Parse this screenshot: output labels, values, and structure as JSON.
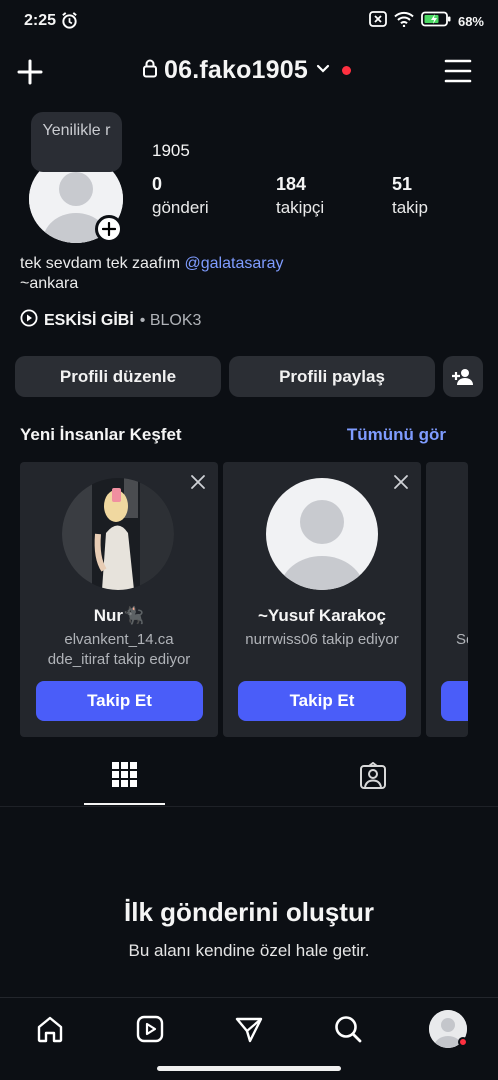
{
  "status_bar": {
    "time": "2:25",
    "battery": "68%"
  },
  "header": {
    "username": "06.fako1905"
  },
  "tooltip": {
    "text": "Yenilikle r"
  },
  "profile": {
    "name": "1905",
    "stats": [
      {
        "value": "0",
        "label": "gönderi"
      },
      {
        "value": "184",
        "label": "takipçi"
      },
      {
        "value": "51",
        "label": "takip"
      }
    ],
    "bio_line1": "tek sevdam tek zaafım ",
    "bio_mention": "@galatasaray",
    "bio_line2": "~ankara",
    "music_title": "ESKİSİ GİBİ",
    "music_artist": "• BLOK3"
  },
  "actions": {
    "edit": "Profili düzenle",
    "share": "Profili paylaş"
  },
  "discover": {
    "title": "Yeni İnsanlar Keşfet",
    "see_all": "Tümünü gör",
    "cards": [
      {
        "name": "Nur🐈‍⬛",
        "subtitle_line1": "elvankent_14.ca",
        "subtitle_line2": "dde_itiraf takip ediyor",
        "button": "Takip Et"
      },
      {
        "name": "~Yusuf Karakoç",
        "subtitle_line1": "nurrwiss06 takip ediyor",
        "subtitle_line2": "",
        "button": "Takip Et"
      },
      {
        "name": "",
        "subtitle_line1": "Se",
        "subtitle_line2": "",
        "button": ""
      }
    ]
  },
  "empty_state": {
    "title": "İlk gönderini oluştur",
    "subtitle": "Bu alanı kendine özel hale getir."
  },
  "colors": {
    "background": "#0c0f14",
    "accent_blue": "#4a5df9",
    "link_blue": "#7f9cff",
    "notification_red": "#ff3040"
  }
}
